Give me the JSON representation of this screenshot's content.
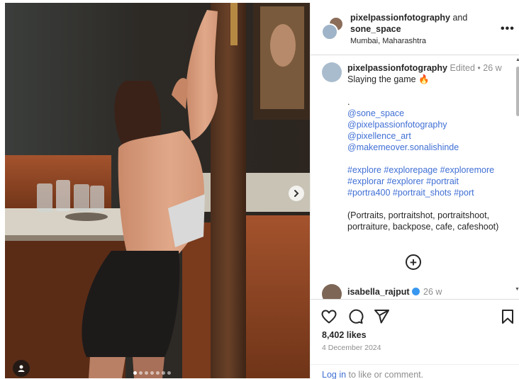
{
  "post": {
    "carousel_dots": 7,
    "active_dot": 0
  },
  "header": {
    "user1": "pixelpassionfotography",
    "joiner": "and",
    "user2": "sone_space",
    "location": "Mumbai, Maharashtra",
    "more_icon": "more-horizontal-icon",
    "more_label": "•••"
  },
  "caption": {
    "author": "pixelpassionfotography",
    "edited": "Edited",
    "separator": "•",
    "time": "26 w",
    "text": "Slaying the game 🔥",
    "dot": ".",
    "mentions": [
      "@sone_space",
      "@pixelpassionfotography",
      "@pixellence_art",
      "@makemeover.sonalishinde"
    ],
    "hashtag_lines": [
      "#explore #explorepage #exploremore",
      "#explorar #explorer #portrait",
      "#portra400 #portrait_shots #port"
    ],
    "keywords_lines": [
      "(Portraits, portraitshot, portraitshoot,",
      "portraiture, backpose, cafe, cafeshoot)"
    ],
    "add_icon": "plus-circle-icon",
    "add_label": "+"
  },
  "comment": {
    "user": "isabella_rajput",
    "time": "26 w"
  },
  "actions": {
    "likes": "8,402 likes",
    "date": "4 December 2024",
    "login_link": "Log in",
    "login_rest": " to like or comment."
  },
  "colors": {
    "link": "#3f6fd4",
    "muted": "#8e8e8e",
    "text": "#262626",
    "verified": "#3897f0"
  }
}
